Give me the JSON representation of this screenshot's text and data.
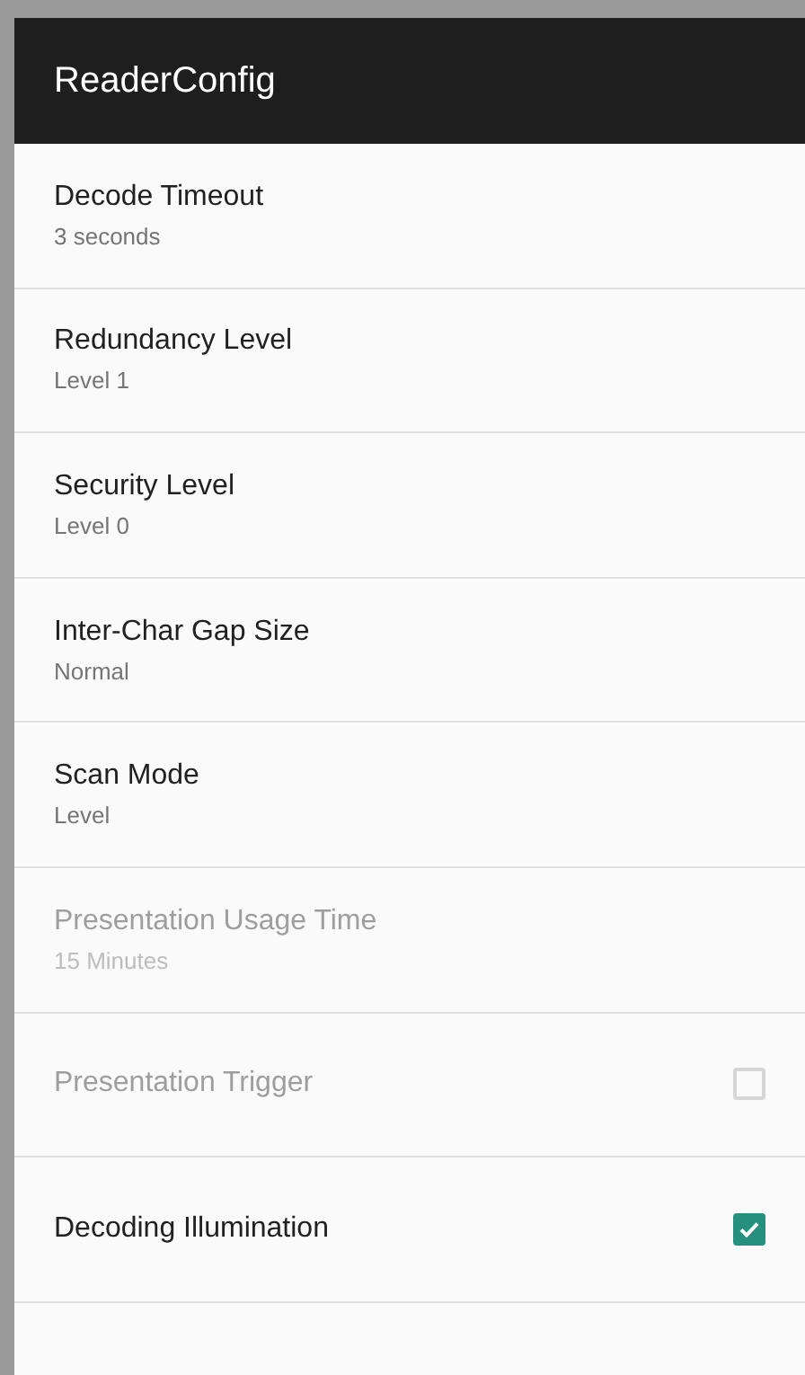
{
  "app_bar": {
    "title": "ReaderConfig"
  },
  "settings": [
    {
      "kind": "value",
      "title": "Decode Timeout",
      "summary": "3 seconds",
      "disabled": false
    },
    {
      "kind": "value",
      "title": "Redundancy Level",
      "summary": "Level 1",
      "disabled": false
    },
    {
      "kind": "value",
      "title": "Security Level",
      "summary": "Level 0",
      "disabled": false
    },
    {
      "kind": "value",
      "title": "Inter-Char Gap Size",
      "summary": "Normal",
      "disabled": false
    },
    {
      "kind": "value",
      "title": "Scan Mode",
      "summary": "Level",
      "disabled": false
    },
    {
      "kind": "value",
      "title": "Presentation Usage Time",
      "summary": "15 Minutes",
      "disabled": true
    },
    {
      "kind": "checkbox",
      "title": "Presentation Trigger",
      "checked": false,
      "disabled": true
    },
    {
      "kind": "checkbox",
      "title": "Decoding Illumination",
      "checked": true,
      "disabled": false
    }
  ]
}
